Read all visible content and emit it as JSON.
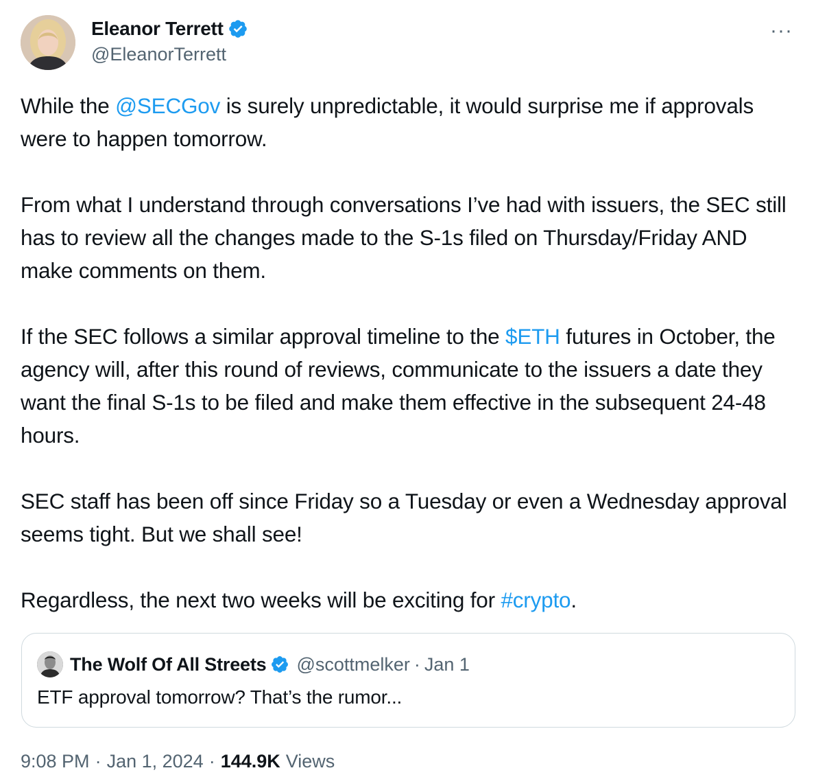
{
  "author": {
    "name": "Eleanor Terrett",
    "handle": "@EleanorTerrett",
    "avatar_icon": "avatar-photo"
  },
  "more_label": "···",
  "body": {
    "p1": {
      "a": "While the ",
      "mention": "@SECGov",
      "b": " is surely unpredictable, it would surprise me if approvals were to happen tomorrow."
    },
    "p2": "From what I understand through conversations I’ve had with issuers, the SEC still has to review all the changes made to the S-1s filed on Thursday/Friday AND make comments on them.",
    "p3": {
      "a": "If the SEC follows a similar approval timeline to the ",
      "cashtag": "$ETH",
      "b": " futures in October, the agency will, after this round of reviews, communicate to the issuers a date they want the final S-1s to be filed and make them effective in the subsequent 24-48 hours."
    },
    "p4": "SEC staff has been off since Friday so a Tuesday or even a Wednesday approval seems tight. But we shall see!",
    "p5": {
      "a": "Regardless, the next two weeks will be exciting for ",
      "hashtag": "#crypto",
      "b": "."
    }
  },
  "quote": {
    "name": "The Wolf Of All Streets",
    "handle": "@scottmelker",
    "separator": "·",
    "date": "Jan 1",
    "text": "ETF approval tomorrow? That’s the rumor..."
  },
  "footer": {
    "time": "9:08 PM",
    "sep": "·",
    "date": "Jan 1, 2024",
    "views_count": "144.9K",
    "views_label": "Views"
  },
  "colors": {
    "link": "#1d9bf0",
    "verified": "#1d9bf0",
    "text": "#0f1419",
    "muted": "#536471",
    "border": "#cfd9de"
  }
}
